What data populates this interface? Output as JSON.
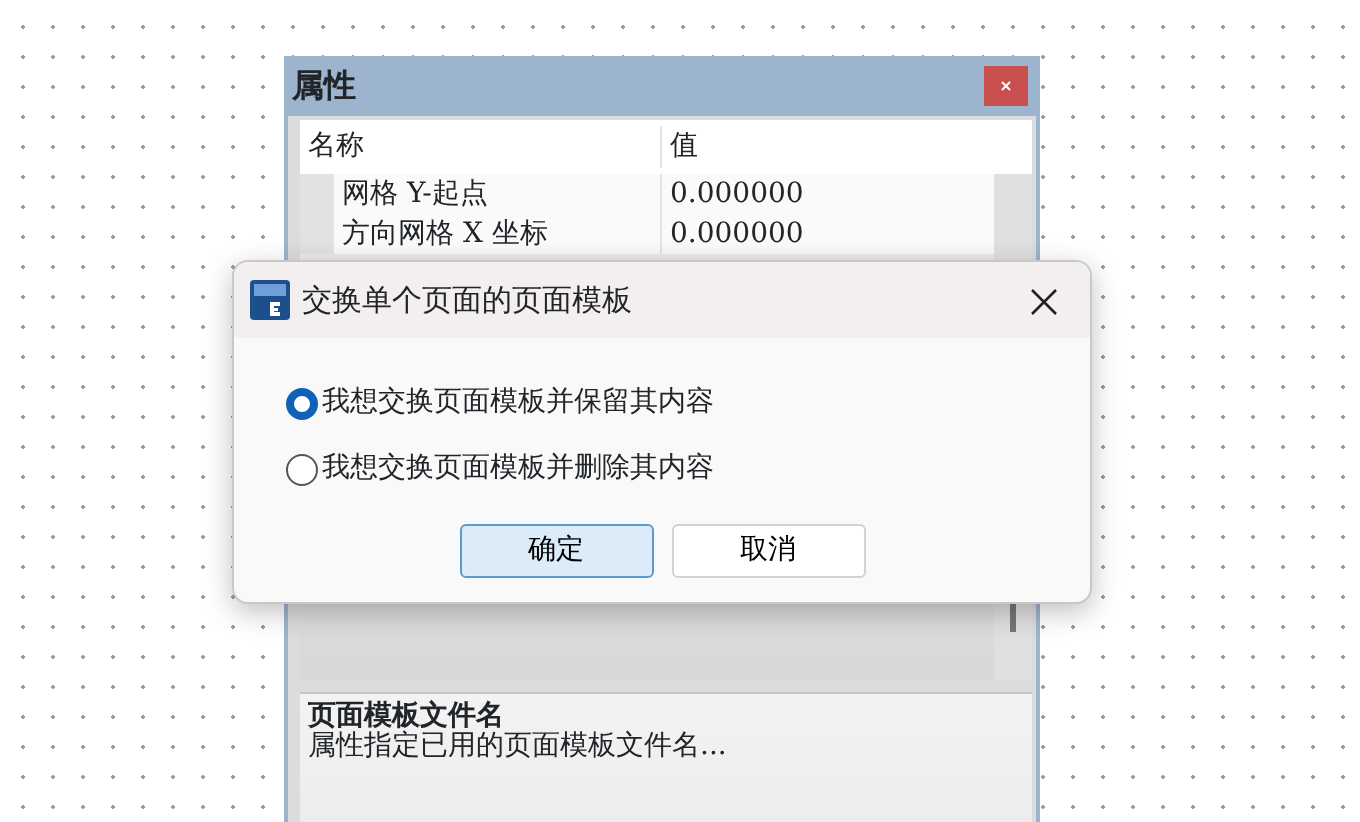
{
  "panel": {
    "title": "属性",
    "columns": [
      "名称",
      "值"
    ],
    "rows": [
      {
        "name": "网格 Y-起点",
        "value": "0.000000"
      },
      {
        "name": "方向网格 X 坐标",
        "value": "0.000000"
      }
    ],
    "description": {
      "title": "页面模板文件名",
      "text": "属性指定已用的页面模板文件名..."
    }
  },
  "dialog": {
    "title": "交换单个页面的页面模板",
    "options": [
      {
        "label": "我想交换页面模板并保留其内容",
        "selected": true
      },
      {
        "label": "我想交换页面模板并删除其内容",
        "selected": false
      }
    ],
    "buttons": [
      {
        "label": "确定",
        "kind": "default"
      },
      {
        "label": "取消",
        "kind": "normal"
      }
    ]
  }
}
